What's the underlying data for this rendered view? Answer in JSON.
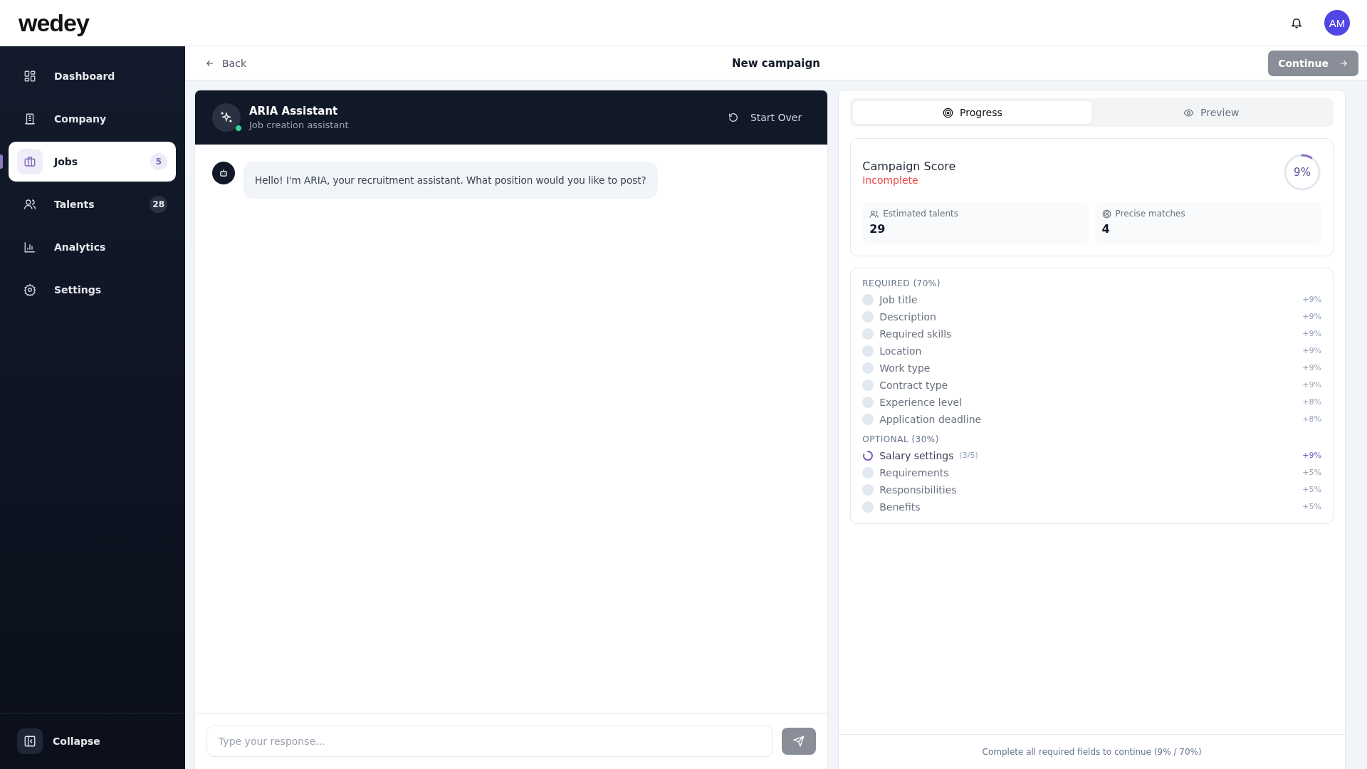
{
  "logo": "wedey",
  "user": {
    "initials": "AM"
  },
  "sidebar": {
    "items": [
      {
        "label": "Dashboard",
        "selected": false
      },
      {
        "label": "Company",
        "selected": false
      },
      {
        "label": "Jobs",
        "badge": "5",
        "selected": true
      },
      {
        "label": "Talents",
        "badge": "28",
        "selected": false
      },
      {
        "label": "Analytics",
        "selected": false
      },
      {
        "label": "Settings",
        "selected": false
      }
    ],
    "collapse": "Collapse"
  },
  "page_header": {
    "back": "Back",
    "title": "New campaign",
    "continue": {
      "label": "Continue",
      "disabled": true
    }
  },
  "chat": {
    "title": "ARIA Assistant",
    "subtitle": "Job creation assistant",
    "online": true,
    "start_over": "Start Over",
    "messages": [
      {
        "text": "Hello! I'm ARIA, your recruitment assistant. What position would you like to post?"
      }
    ],
    "input": {
      "placeholder": "Type your response..."
    }
  },
  "tabs": [
    {
      "label": "Progress",
      "selected": true
    },
    {
      "label": "Preview",
      "selected": false
    }
  ],
  "score": {
    "title": "Campaign Score",
    "status": "Incomplete",
    "complete": false,
    "level": 0.09,
    "value": "9%",
    "stats": [
      {
        "label": "Estimated talents",
        "value": "29"
      },
      {
        "label": "Precise matches",
        "value": "4"
      }
    ]
  },
  "checklist": [
    {
      "heading": "REQUIRED (70%)",
      "items": [
        {
          "label": "Job title",
          "points": "+9%",
          "in_progress": false
        },
        {
          "label": "Description",
          "points": "+9%",
          "in_progress": false
        },
        {
          "label": "Required skills",
          "points": "+9%",
          "in_progress": false
        },
        {
          "label": "Location",
          "points": "+9%",
          "in_progress": false
        },
        {
          "label": "Work type",
          "points": "+9%",
          "in_progress": false
        },
        {
          "label": "Contract type",
          "points": "+9%",
          "in_progress": false
        },
        {
          "label": "Experience level",
          "points": "+8%",
          "in_progress": false
        },
        {
          "label": "Application deadline",
          "points": "+8%",
          "in_progress": false
        }
      ]
    },
    {
      "heading": "OPTIONAL (30%)",
      "items": [
        {
          "label": "Salary settings",
          "count": "(3/5)",
          "points": "+9%",
          "in_progress": true
        },
        {
          "label": "Requirements",
          "points": "+5%",
          "in_progress": false
        },
        {
          "label": "Responsibilities",
          "points": "+5%",
          "in_progress": false
        },
        {
          "label": "Benefits",
          "points": "+5%",
          "in_progress": false
        }
      ]
    }
  ],
  "footer_note": "Complete all required fields to continue (9% / 70%)"
}
